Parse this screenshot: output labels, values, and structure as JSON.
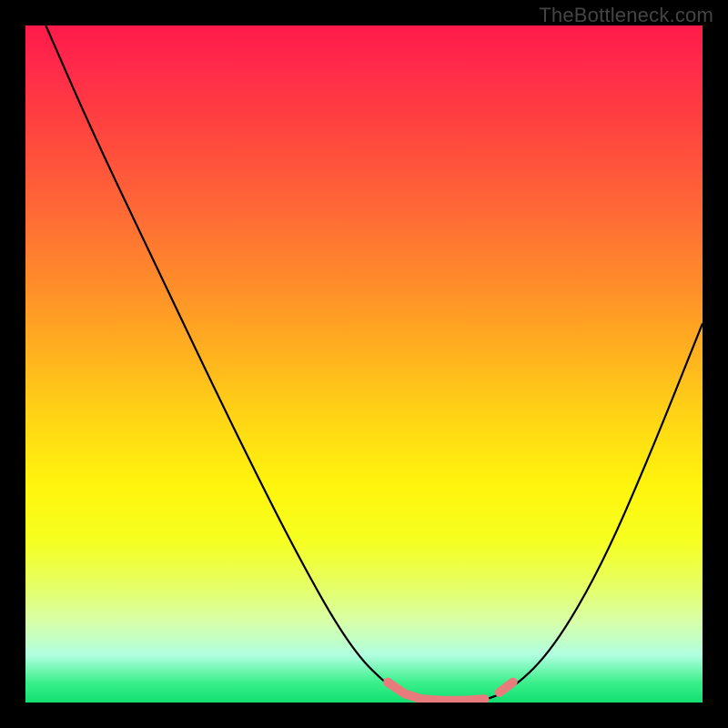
{
  "watermark": "TheBottleneck.com",
  "chart_data": {
    "type": "line",
    "title": "",
    "xlabel": "",
    "ylabel": "",
    "xlim": [
      0,
      1
    ],
    "ylim": [
      0,
      1
    ],
    "series": [
      {
        "name": "bottleneck-curve",
        "x": [
          0.03,
          0.1,
          0.2,
          0.3,
          0.4,
          0.48,
          0.54,
          0.58,
          0.62,
          0.67,
          0.72,
          0.78,
          0.85,
          0.92,
          1.0
        ],
        "y": [
          1.0,
          0.84,
          0.63,
          0.42,
          0.22,
          0.08,
          0.02,
          0.0,
          0.0,
          0.0,
          0.02,
          0.08,
          0.2,
          0.36,
          0.56
        ]
      }
    ],
    "markers": {
      "name": "highlight-region",
      "color": "#e87c7c",
      "segments": [
        {
          "x0": 0.535,
          "y0": 0.03,
          "x1": 0.56,
          "y1": 0.013
        },
        {
          "x0": 0.56,
          "y0": 0.013,
          "x1": 0.585,
          "y1": 0.005
        },
        {
          "x0": 0.585,
          "y0": 0.005,
          "x1": 0.615,
          "y1": 0.003
        },
        {
          "x0": 0.615,
          "y0": 0.003,
          "x1": 0.648,
          "y1": 0.003
        },
        {
          "x0": 0.648,
          "y0": 0.003,
          "x1": 0.678,
          "y1": 0.005
        },
        {
          "x0": 0.7,
          "y0": 0.015,
          "x1": 0.72,
          "y1": 0.03
        }
      ]
    },
    "gradient": {
      "top": "#ff1a4a",
      "mid": "#fff50d",
      "bottom": "#10e070"
    }
  }
}
